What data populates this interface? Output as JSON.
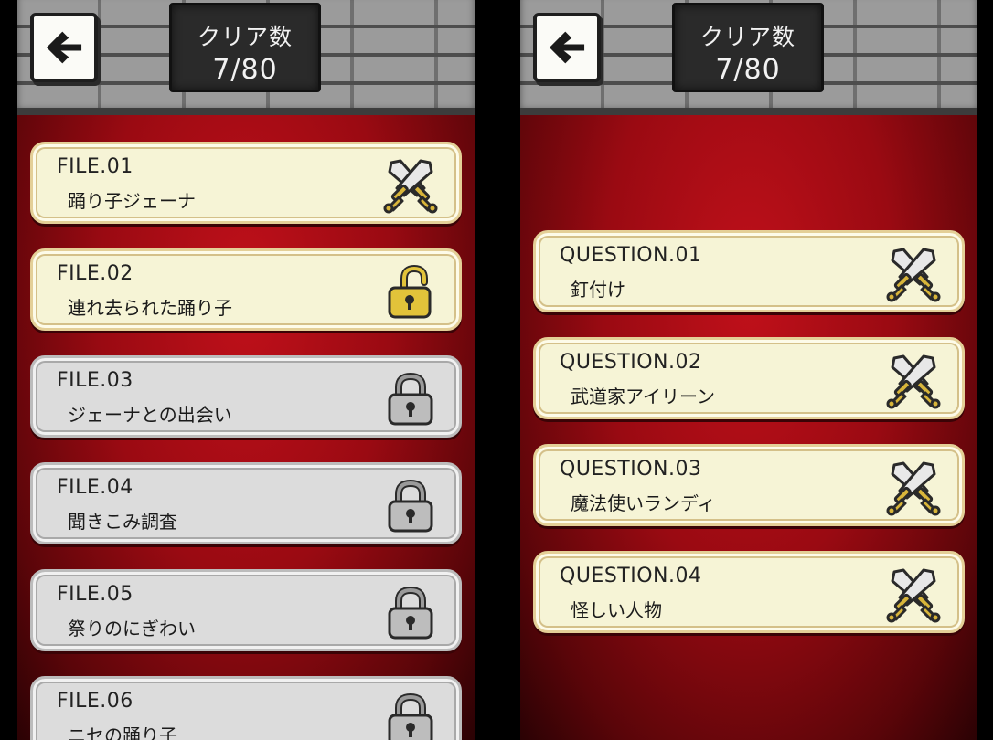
{
  "screens": [
    {
      "back_icon": "left-arrow-icon",
      "counter": {
        "title": "クリア数",
        "value": "7/80"
      },
      "items": [
        {
          "id": "FILE.01",
          "name": "踊り子ジェーナ",
          "state": "cleared",
          "icon": "crossed-swords-icon"
        },
        {
          "id": "FILE.02",
          "name": "連れ去られた踊り子",
          "state": "unlocked",
          "icon": "open-padlock-icon"
        },
        {
          "id": "FILE.03",
          "name": "ジェーナとの出会い",
          "state": "locked",
          "icon": "padlock-icon"
        },
        {
          "id": "FILE.04",
          "name": "聞きこみ調査",
          "state": "locked",
          "icon": "padlock-icon"
        },
        {
          "id": "FILE.05",
          "name": "祭りのにぎわい",
          "state": "locked",
          "icon": "padlock-icon"
        },
        {
          "id": "FILE.06",
          "name": "ニセの踊り子",
          "state": "locked",
          "icon": "padlock-icon"
        }
      ]
    },
    {
      "back_icon": "left-arrow-icon",
      "counter": {
        "title": "クリア数",
        "value": "7/80"
      },
      "items": [
        {
          "id": "QUESTION.01",
          "name": "釘付け",
          "state": "cleared",
          "icon": "crossed-swords-icon"
        },
        {
          "id": "QUESTION.02",
          "name": "武道家アイリーン",
          "state": "cleared",
          "icon": "crossed-swords-icon"
        },
        {
          "id": "QUESTION.03",
          "name": "魔法使いランディ",
          "state": "cleared",
          "icon": "crossed-swords-icon"
        },
        {
          "id": "QUESTION.04",
          "name": "怪しい人物",
          "state": "cleared",
          "icon": "crossed-swords-icon"
        }
      ]
    }
  ],
  "colors": {
    "background_red": "#b80d16",
    "card_cream": "#f6f4d6",
    "card_locked": "#dcdcdc",
    "lock_gold": "#e2c33a"
  }
}
